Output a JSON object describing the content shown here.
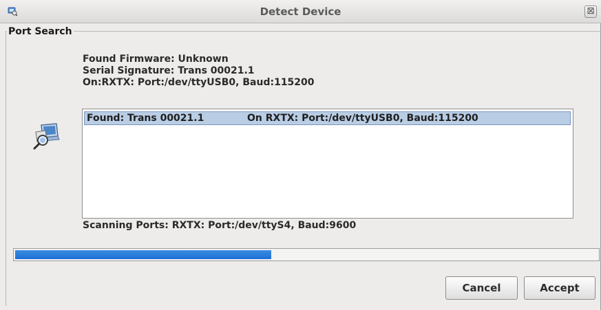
{
  "window": {
    "title": "Detect Device",
    "title_icon": "app-icon",
    "close_glyph": "⊠"
  },
  "port_search": {
    "legend": "Port Search",
    "found_firmware": "Found Firmware: Unknown",
    "serial_signature": "Serial Signature: Trans 00021.1",
    "on_port": "On:RXTX: Port:/dev/ttyUSB0, Baud:115200",
    "device_icon": "device-search-icon",
    "results": [
      {
        "found": "Found: Trans 00021.1",
        "port": "On RXTX: Port:/dev/ttyUSB0, Baud:115200",
        "selected": true
      }
    ],
    "scanning": "Scanning Ports: RXTX: Port:/dev/ttyS4, Baud:9600"
  },
  "progress": {
    "value": 0.44,
    "color": "#1a6fd6"
  },
  "buttons": {
    "cancel": "Cancel",
    "accept": "Accept"
  }
}
